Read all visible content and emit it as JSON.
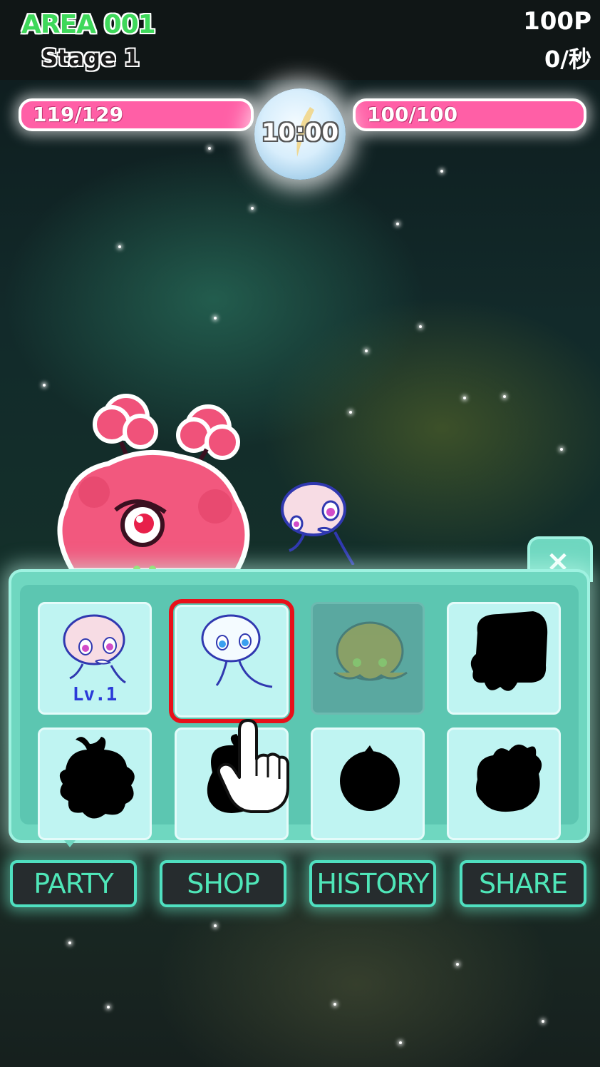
{
  "header": {
    "area": "AREA 001",
    "stage": "Stage 1",
    "points": "100P",
    "rate": "0/秒"
  },
  "battle": {
    "enemy_hp": {
      "text": "119/129",
      "current": 119,
      "max": 129
    },
    "player_hp": {
      "text": "100/100",
      "current": 100,
      "max": 100
    },
    "timer": "10:00"
  },
  "party_panel": {
    "close_label": "×",
    "slots": [
      {
        "state": "owned",
        "creature": "pink-jellyfish",
        "level": "Lv.1"
      },
      {
        "state": "selected",
        "creature": "blue-jellyfish",
        "level": ""
      },
      {
        "state": "dim",
        "creature": "octopus",
        "level": ""
      },
      {
        "state": "silhouette",
        "creature": "unknown",
        "level": ""
      },
      {
        "state": "silhouette",
        "creature": "unknown",
        "level": ""
      },
      {
        "state": "silhouette",
        "creature": "unknown",
        "level": ""
      },
      {
        "state": "silhouette",
        "creature": "unknown",
        "level": ""
      },
      {
        "state": "silhouette",
        "creature": "unknown",
        "level": ""
      }
    ]
  },
  "nav": {
    "party": "PARTY",
    "shop": "SHOP",
    "history": "HISTORY",
    "share": "SHARE"
  },
  "colors": {
    "hp_bar": "#ff5fa6",
    "panel": "#6fd7c0",
    "slot": "#bff4f2",
    "button_text": "#4fe6b8",
    "selection": "#e8101a",
    "area_text": "#3ed85a"
  },
  "icons": [
    "close-icon",
    "pointing-hand-icon",
    "comet-icon"
  ]
}
